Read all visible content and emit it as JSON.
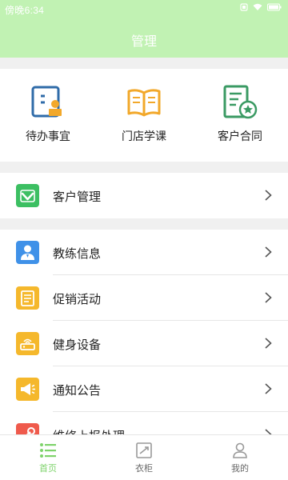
{
  "status_bar": {
    "time": "傍晚6:34",
    "icons": [
      "sim-icon",
      "wifi-icon",
      "battery-icon"
    ]
  },
  "header": {
    "title": "管理",
    "background": "#c1f2b3"
  },
  "quick_actions": [
    {
      "label": "待办事宜",
      "icon": "todo-icon"
    },
    {
      "label": "门店学课",
      "icon": "book-icon"
    },
    {
      "label": "客户合同",
      "icon": "contract-icon"
    }
  ],
  "menu_group_1": [
    {
      "label": "客户管理",
      "icon": "customer-management-icon",
      "color": "#3cbf62"
    }
  ],
  "menu_group_2": [
    {
      "label": "教练信息",
      "icon": "coach-icon",
      "color": "#3f91e8"
    },
    {
      "label": "促销活动",
      "icon": "promotion-icon",
      "color": "#f5b82c"
    },
    {
      "label": "健身设备",
      "icon": "equipment-icon",
      "color": "#f5b82c"
    },
    {
      "label": "通知公告",
      "icon": "announcement-icon",
      "color": "#f5b82c"
    },
    {
      "label": "维修上报处理",
      "icon": "repair-icon",
      "color": "#ef5a4c"
    }
  ],
  "tabbar": {
    "tabs": [
      {
        "label": "首页",
        "icon": "home-list-icon",
        "active": true
      },
      {
        "label": "衣柜",
        "icon": "wardrobe-icon",
        "active": false
      },
      {
        "label": "我的",
        "icon": "profile-icon",
        "active": false
      }
    ],
    "active_color": "#7ed36b"
  }
}
